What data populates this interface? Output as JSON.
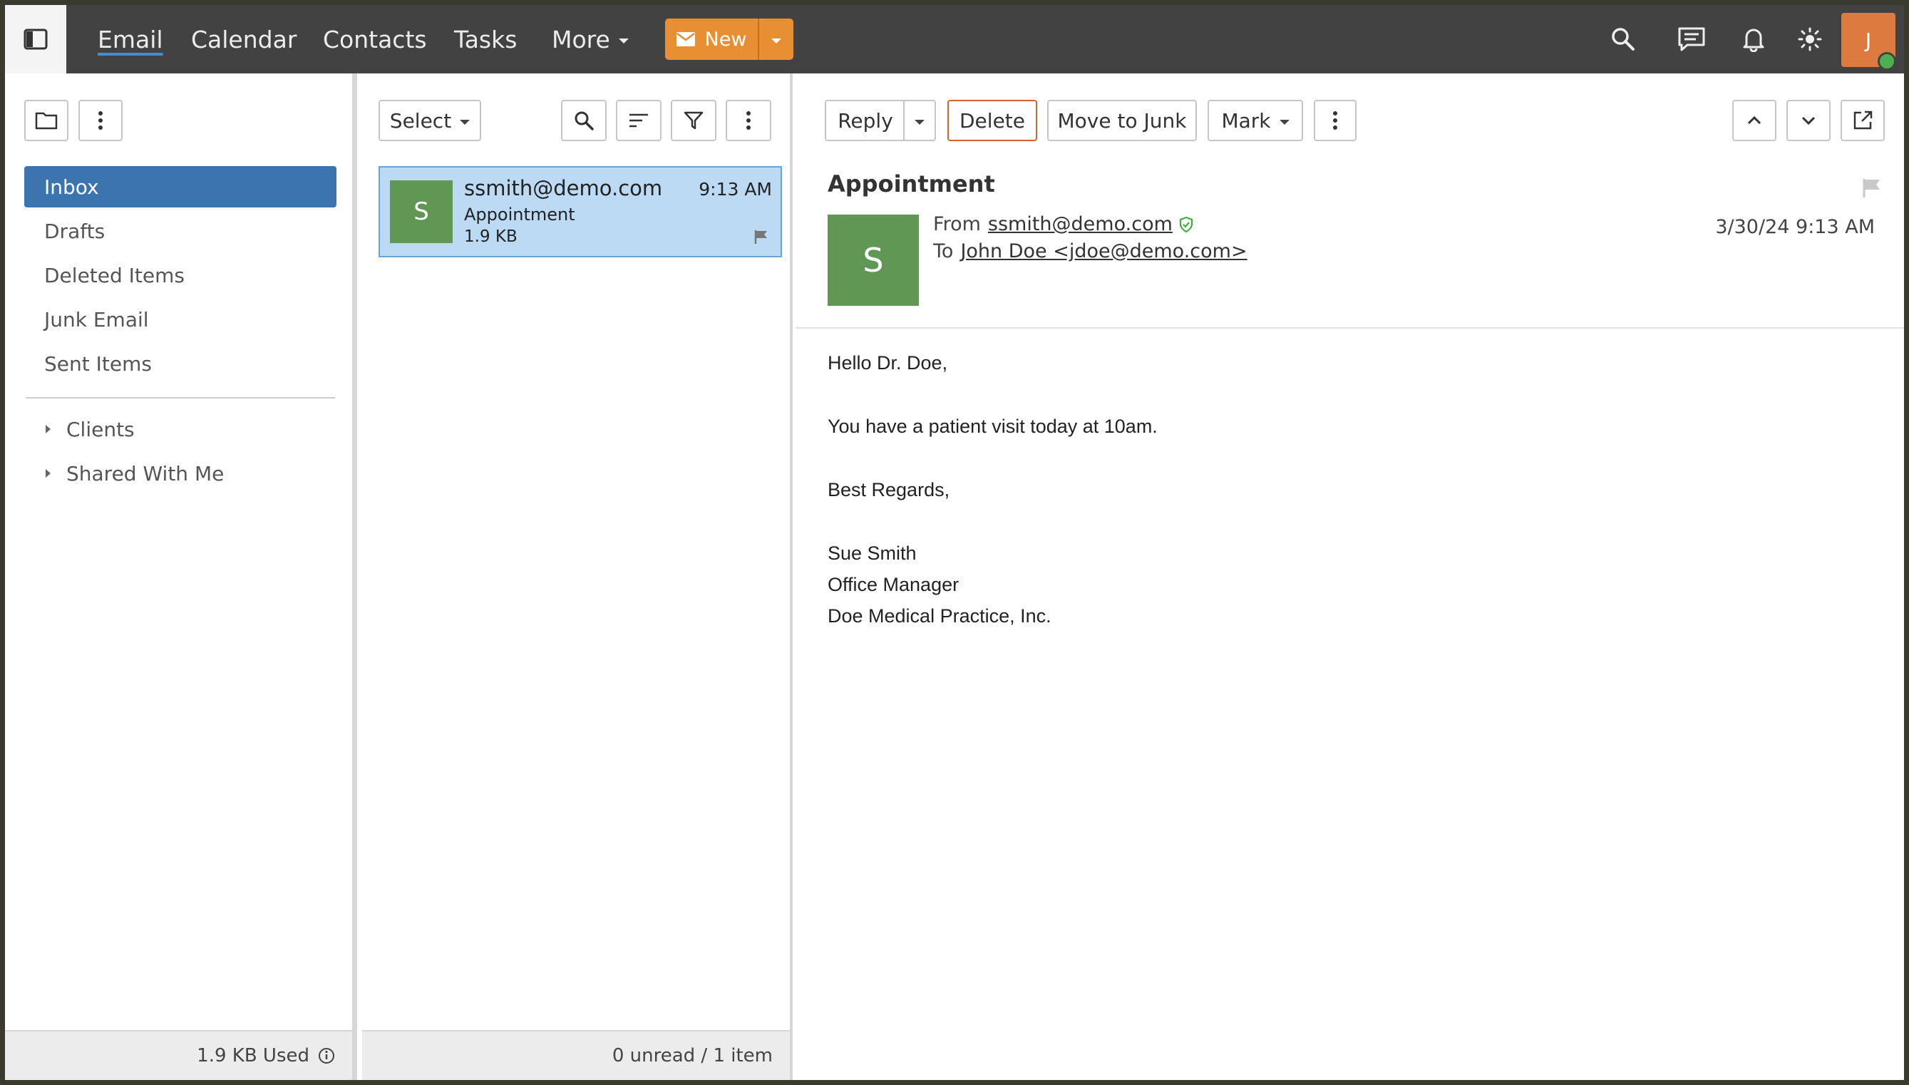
{
  "nav": {
    "items": [
      "Email",
      "Calendar",
      "Contacts",
      "Tasks",
      "More"
    ],
    "new_label": "New",
    "user_initial": "J"
  },
  "folders": {
    "items": [
      "Inbox",
      "Drafts",
      "Deleted Items",
      "Junk Email",
      "Sent Items"
    ],
    "groups": [
      "Clients",
      "Shared With Me"
    ],
    "footer": "1.9 KB Used"
  },
  "list": {
    "select_label": "Select",
    "message": {
      "initial": "S",
      "from": "ssmith@demo.com",
      "time": "9:13 AM",
      "subject": "Appointment",
      "size": "1.9 KB"
    },
    "footer": "0 unread / 1 item"
  },
  "reader": {
    "toolbar": {
      "reply": "Reply",
      "delete": "Delete",
      "move_to_junk": "Move to Junk",
      "mark": "Mark"
    },
    "subject": "Appointment",
    "sender_initial": "S",
    "from_label": "From",
    "from": "ssmith@demo.com",
    "to_label": "To",
    "to": "John Doe <jdoe@demo.com>",
    "date": "3/30/24 9:13 AM",
    "body": {
      "greeting": "Hello Dr. Doe,",
      "line1": "You have a patient visit today at 10am.",
      "closing": "Best Regards,",
      "sig_name": "Sue Smith",
      "sig_title": "Office Manager",
      "sig_company": "Doe Medical Practice, Inc."
    }
  },
  "colors": {
    "topbar": "#424242",
    "accent_orange": "#e88e33",
    "selected_folder": "#3c74b0",
    "selected_message": "#bcdaf4",
    "avatar_green": "#619755",
    "delete_border": "#d9612d"
  }
}
